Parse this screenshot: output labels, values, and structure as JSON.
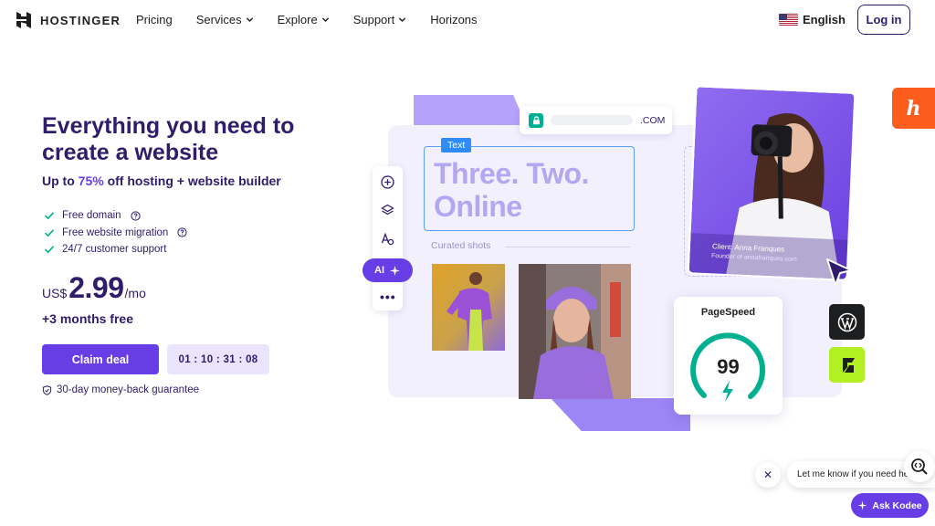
{
  "nav": {
    "brand": "HOSTINGER",
    "links": [
      {
        "label": "Pricing",
        "has_dropdown": false
      },
      {
        "label": "Services",
        "has_dropdown": true
      },
      {
        "label": "Explore",
        "has_dropdown": true
      },
      {
        "label": "Support",
        "has_dropdown": true
      },
      {
        "label": "Horizons",
        "has_dropdown": false
      }
    ],
    "language": "English",
    "login": "Log in"
  },
  "hero": {
    "title": "Everything you need to create a website",
    "subtitle_prefix": "Up to ",
    "subtitle_percent": "75%",
    "subtitle_suffix": " off hosting + website builder",
    "features": [
      {
        "label": "Free domain",
        "help": true
      },
      {
        "label": "Free website migration",
        "help": true
      },
      {
        "label": "24/7 customer support",
        "help": false
      }
    ],
    "currency": "US$",
    "price": "2.99",
    "period": "/mo",
    "bonus": "+3 months free",
    "cta": "Claim deal",
    "countdown": "01 : 10 : 31 : 08",
    "guarantee": "30-day money-back guarantee"
  },
  "builder": {
    "domain_tld": ".COM",
    "text_tag": "Text",
    "headline_line1": "Three. Two.",
    "headline_line2": "Online",
    "curated_label": "Curated shots",
    "ai_label": "AI",
    "more_label": "•••",
    "client_name": "Client: Anna Franques",
    "client_sub": "Founder of annafranques.com",
    "pagespeed_title": "PageSpeed",
    "pagespeed_score": "99",
    "pagespeed_value": 0.99
  },
  "chat": {
    "close": "✕",
    "message": "Let me know if you need help",
    "ask_button": "Ask Kodee"
  },
  "colors": {
    "brand_purple": "#673de6",
    "dark_purple": "#2f1c6a",
    "check_green": "#00b090",
    "kodee_orange": "#fc5d1c",
    "lime": "#b2f024"
  }
}
